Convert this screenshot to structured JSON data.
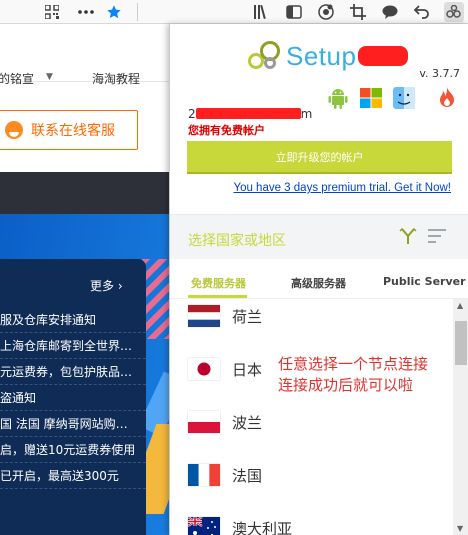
{
  "toolbar": {
    "left_icons": [
      "qr-code-icon",
      "more-icon",
      "star-icon"
    ],
    "right_icons": [
      "library-icon",
      "sidebar-icon",
      "account-icon",
      "crop-icon",
      "chat-icon",
      "undo-icon",
      "extension-icon"
    ]
  },
  "page": {
    "nav_item_1": "的铭宣",
    "nav_item_2": "海淘教程",
    "support_button": "联系在线客服",
    "news_more": "更多 ›",
    "news_items": [
      "服及仓库安排通知",
      "上海仓库邮寄到全世界…",
      "元运费券，包包护肤品…",
      "盗通知",
      "国  法国  摩纳哥网站购…",
      "启，赠送10元运费券使用",
      "已开启，最高送300元"
    ]
  },
  "popup": {
    "logo_text": "Setup",
    "version": "v. 3.7.7",
    "os_icons": [
      "android-icon",
      "windows-icon",
      "mac-finder-icon",
      "flame-icon"
    ],
    "account_line_start": "2",
    "account_line_end": "m",
    "account_note": "您拥有免费帐户",
    "upgrade_button": "立即升级您的帐户",
    "trial_link": "You have 3 days premium trial. Get it Now!",
    "region_label": "选择国家或地区",
    "tabs": [
      "免费服务器",
      "高级服务器",
      "Public Server"
    ],
    "servers": [
      {
        "name": "荷兰",
        "flag": "nl"
      },
      {
        "name": "日本",
        "flag": "jp"
      },
      {
        "name": "波兰",
        "flag": "pl"
      },
      {
        "name": "法国",
        "flag": "fr"
      },
      {
        "name": "澳大利亚",
        "flag": "au"
      }
    ],
    "annotation": "任意选择一个节点连接\n连接成功后就可以啦"
  },
  "colors": {
    "accent_green": "#c8d73a",
    "logo_blue": "#3aaee0",
    "annotation_red": "#e0322e",
    "support_orange": "#ff6a00",
    "trial_link_blue": "#0044cc"
  }
}
